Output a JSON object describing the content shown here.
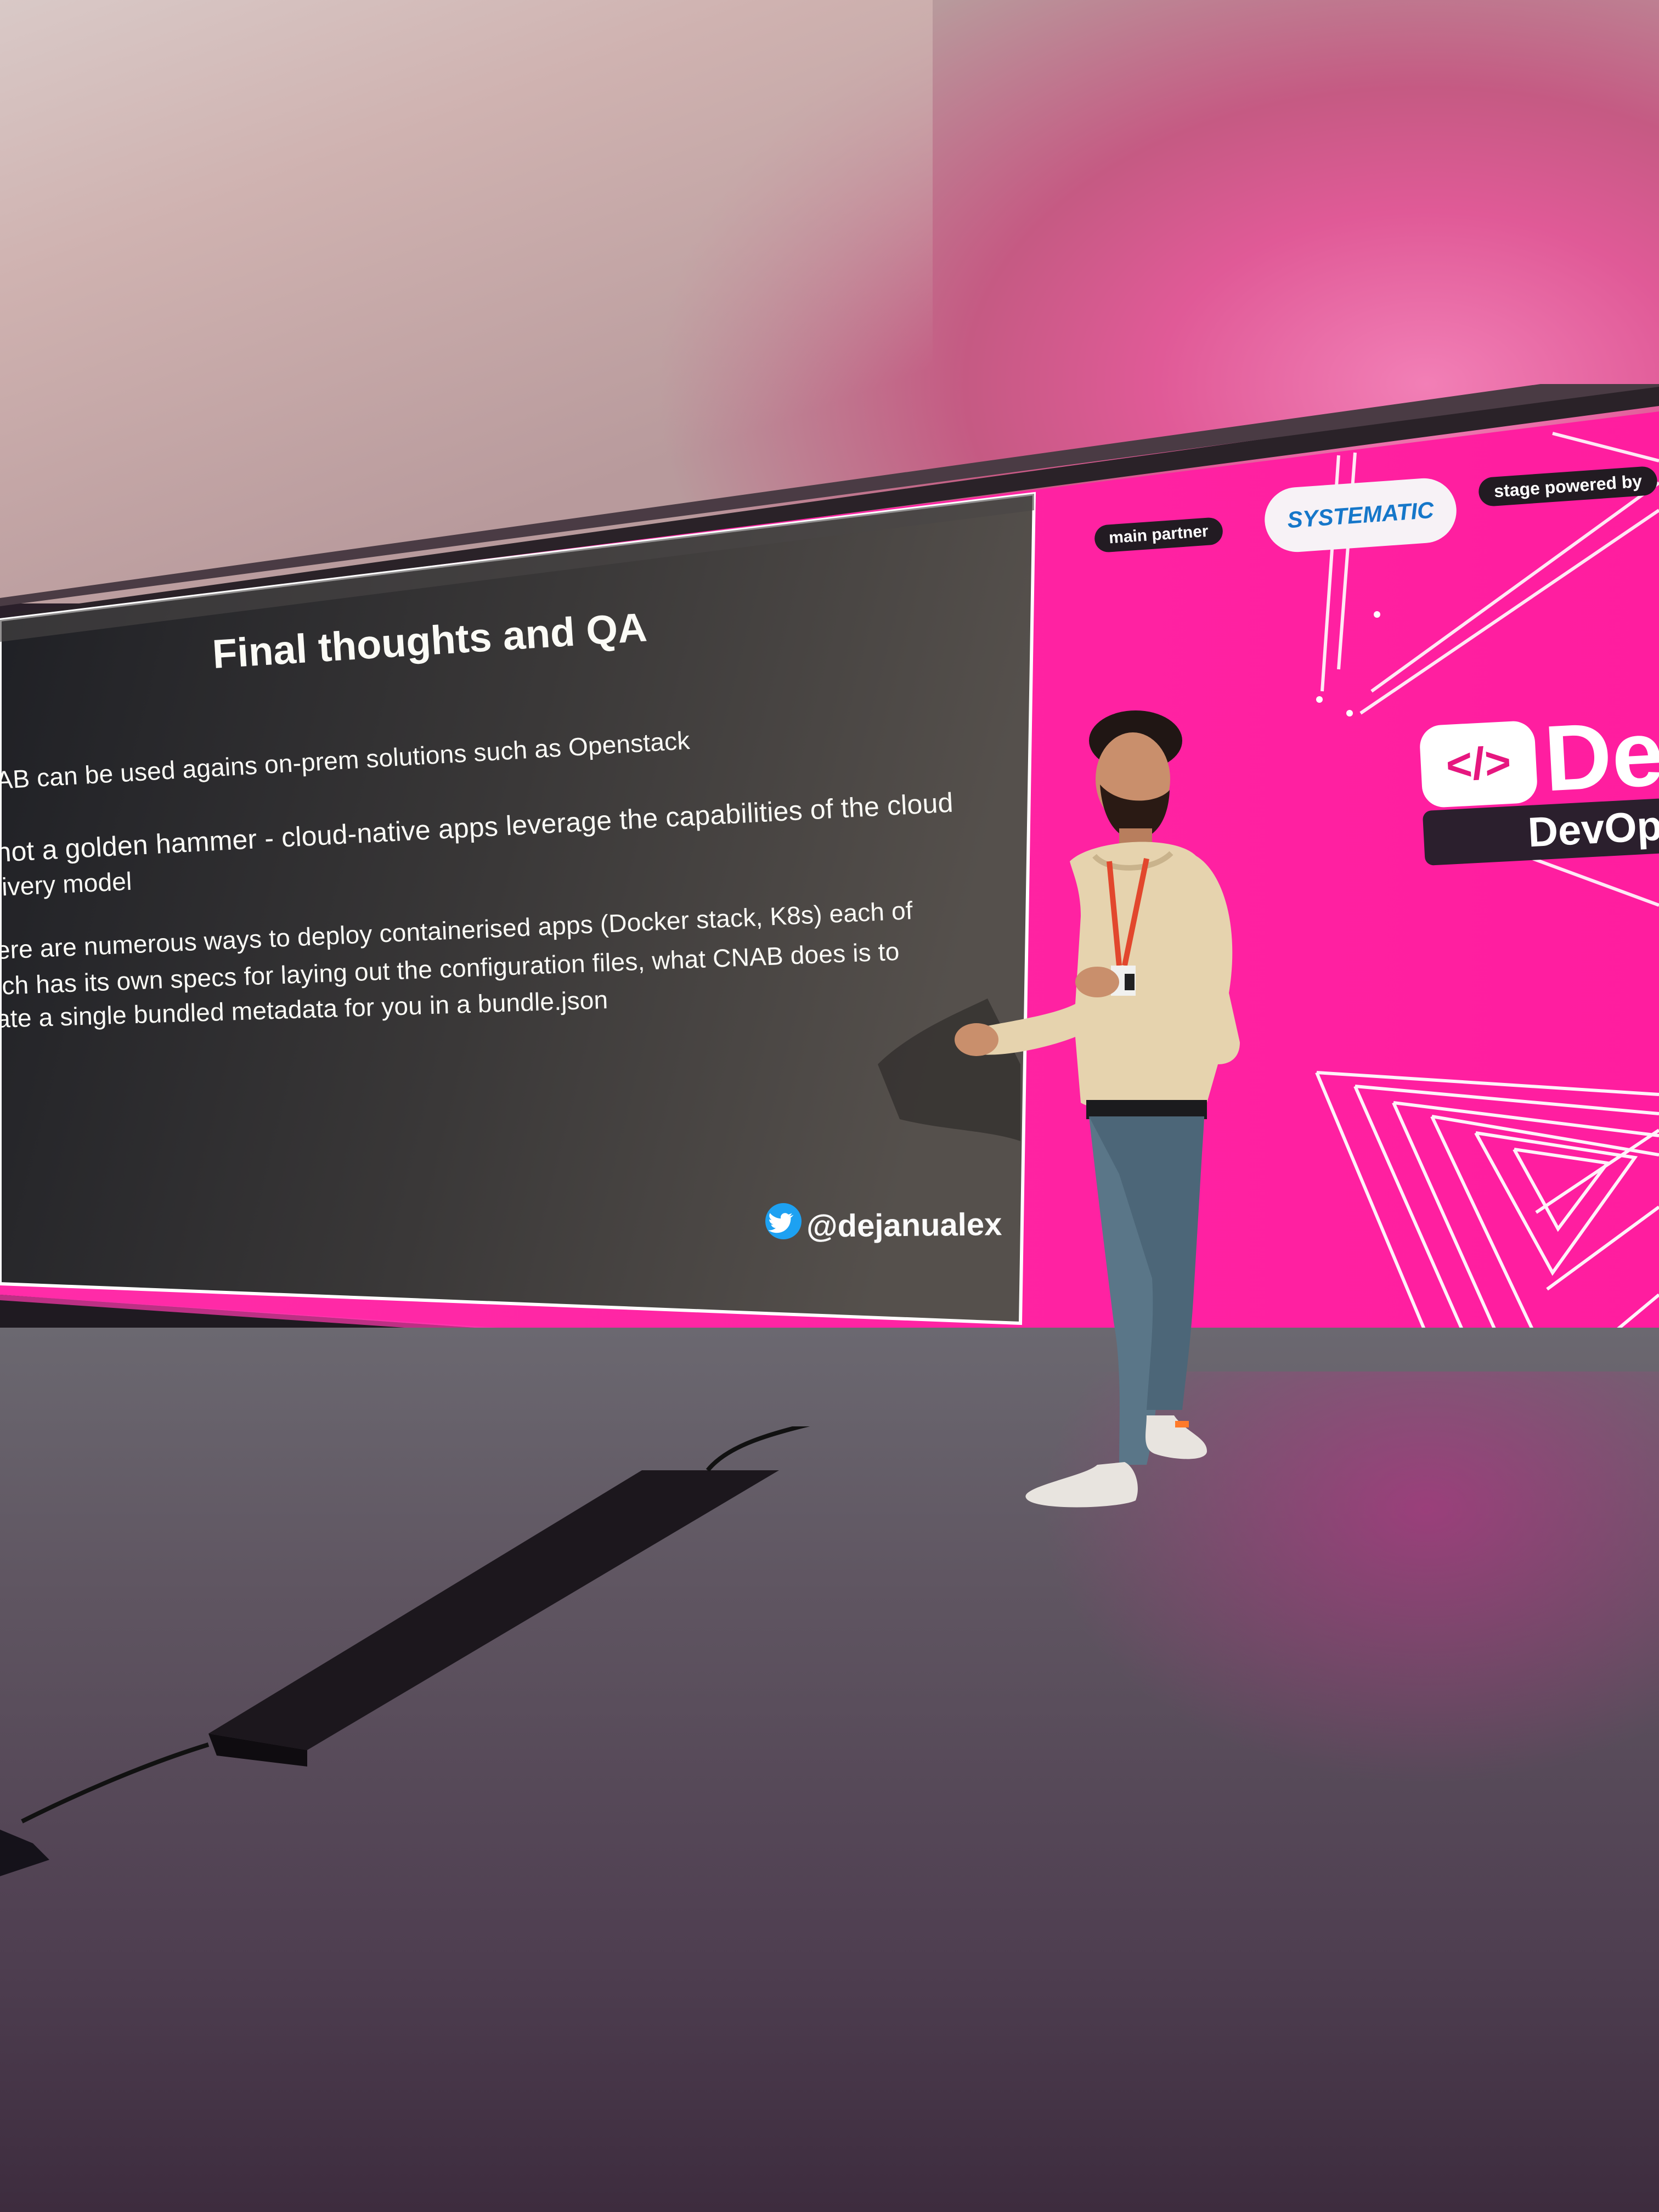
{
  "slide": {
    "title": "Final thoughts and QA",
    "bullets": [
      "AB can be used agains on-prem solutions such as Openstack",
      "not a golden hammer - cloud-native apps leverage the capabilities of the cloud",
      "livery model",
      "ere are numerous ways to deploy containerised apps (Docker stack, K8s) each of",
      "ich has its own specs for laying out the configuration files, what CNAB does is to",
      "ate a single bundled metadata for you in a bundle.json"
    ],
    "handle": "@dejanualex"
  },
  "branding": {
    "main_partner_label": "main partner",
    "partner_name": "SYSTEMATIC",
    "stage_powered_label": "stage powered by",
    "logo_glyph": "</>",
    "brand_title": "De",
    "brand_subtitle": "DevOp"
  },
  "colors": {
    "led_pink": "#ff1fa3",
    "slide_bg": "#2c2a2b",
    "twitter_blue": "#1da1f2"
  }
}
